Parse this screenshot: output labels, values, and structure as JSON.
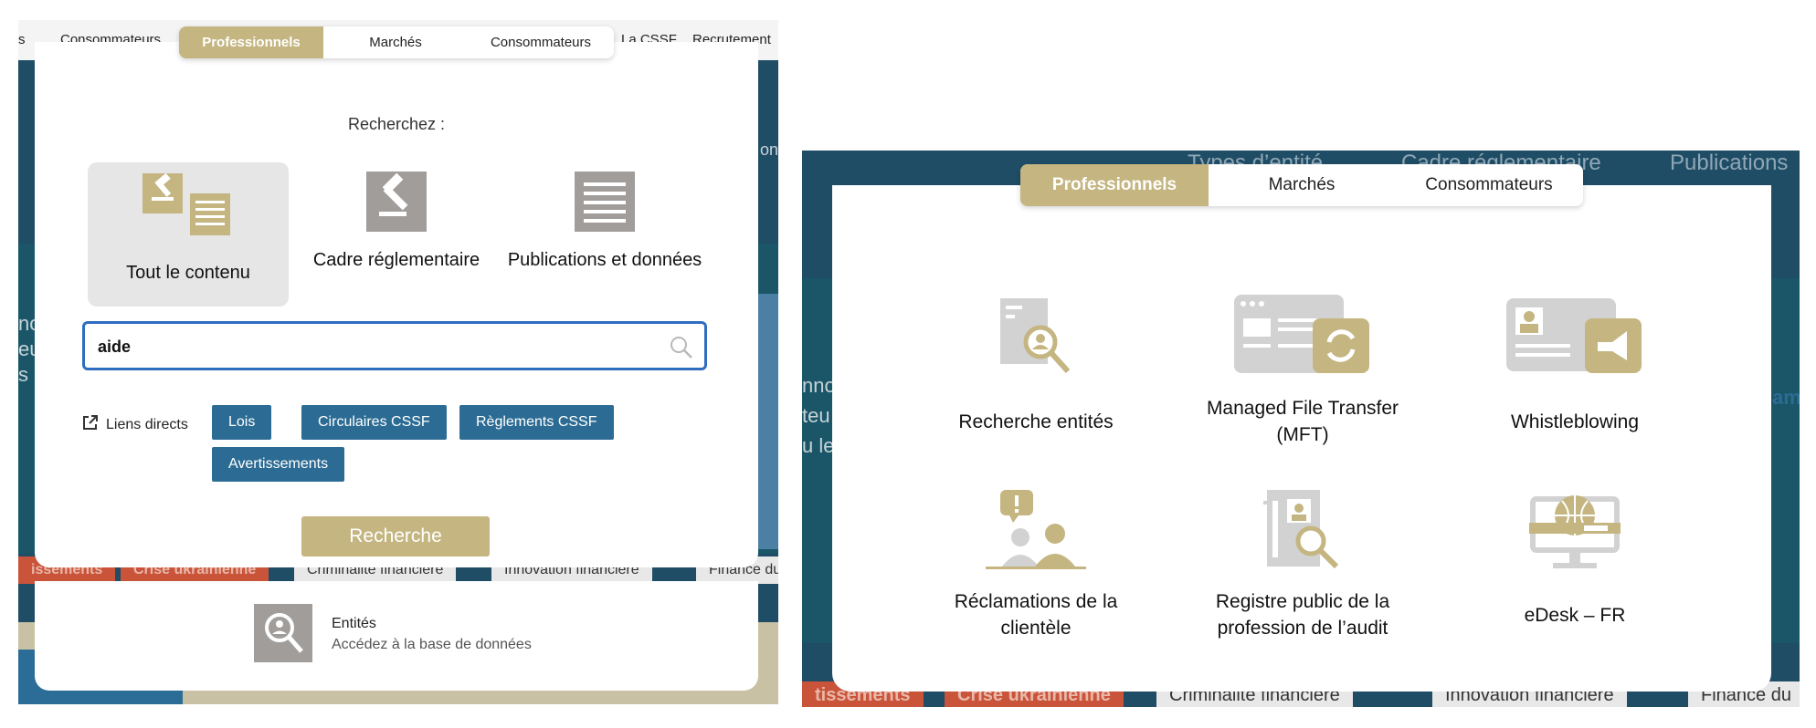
{
  "left": {
    "background": {
      "top_nav": [
        "s",
        "Consommateurs",
        "La CSSF",
        "Recrutement"
      ],
      "side_text": [
        "no",
        "eu",
        "s le"
      ],
      "ons_text": "ons",
      "tags": [
        "issements",
        "Crise ukrainienne",
        "Criminalité financière",
        "Innovation financière",
        "Finance du"
      ]
    },
    "tabs": [
      {
        "label": "Professionnels",
        "active": true
      },
      {
        "label": "Marchés",
        "active": false
      },
      {
        "label": "Consommateurs",
        "active": false
      }
    ],
    "search_title": "Recherchez :",
    "scopes": [
      {
        "label": "Tout le contenu",
        "icon": "gavel-document-icon",
        "selected": true
      },
      {
        "label": "Cadre réglementaire",
        "icon": "gavel-icon",
        "selected": false
      },
      {
        "label": "Publications et données",
        "icon": "document-lines-icon",
        "selected": false
      }
    ],
    "search": {
      "value": "aide",
      "placeholder": ""
    },
    "quick_links": {
      "label": "Liens directs",
      "items": [
        "Lois",
        "Circulaires CSSF",
        "Règlements CSSF",
        "Avertissements"
      ]
    },
    "submit_label": "Recherche",
    "entity_card": {
      "title": "Entités",
      "description": "Accédez à la base de données"
    }
  },
  "right": {
    "background": {
      "nav_items": [
        "Types d’entité",
        "Cadre réglementaire",
        "Publications"
      ],
      "side_text": [
        "nno",
        "teu",
        "u le"
      ],
      "side_right": "am",
      "tags": [
        "tissements",
        "Crise ukrainienne",
        "Criminalité financière",
        "Innovation financière",
        "Finance du"
      ]
    },
    "tabs": [
      {
        "label": "Professionnels",
        "active": true
      },
      {
        "label": "Marchés",
        "active": false
      },
      {
        "label": "Consommateurs",
        "active": false
      }
    ],
    "tiles": [
      {
        "label": "Recherche entités",
        "icon": "entity-search-icon"
      },
      {
        "label": "Managed File Transfer (MFT)",
        "icon": "file-transfer-icon"
      },
      {
        "label": "Whistleblowing",
        "icon": "megaphone-card-icon"
      },
      {
        "label": "Réclamations de la clientèle",
        "icon": "customer-complaint-icon"
      },
      {
        "label": "Registre public de la profession de l’audit",
        "icon": "audit-register-icon"
      },
      {
        "label": "eDesk – FR",
        "icon": "edesk-globe-icon"
      }
    ]
  },
  "colors": {
    "gold": "#c4b581",
    "blue_button": "#2c6c94",
    "dark_bg": "#1f4d66",
    "focus_border": "#2f6dbf",
    "icon_grey": "#d2d2d2"
  }
}
